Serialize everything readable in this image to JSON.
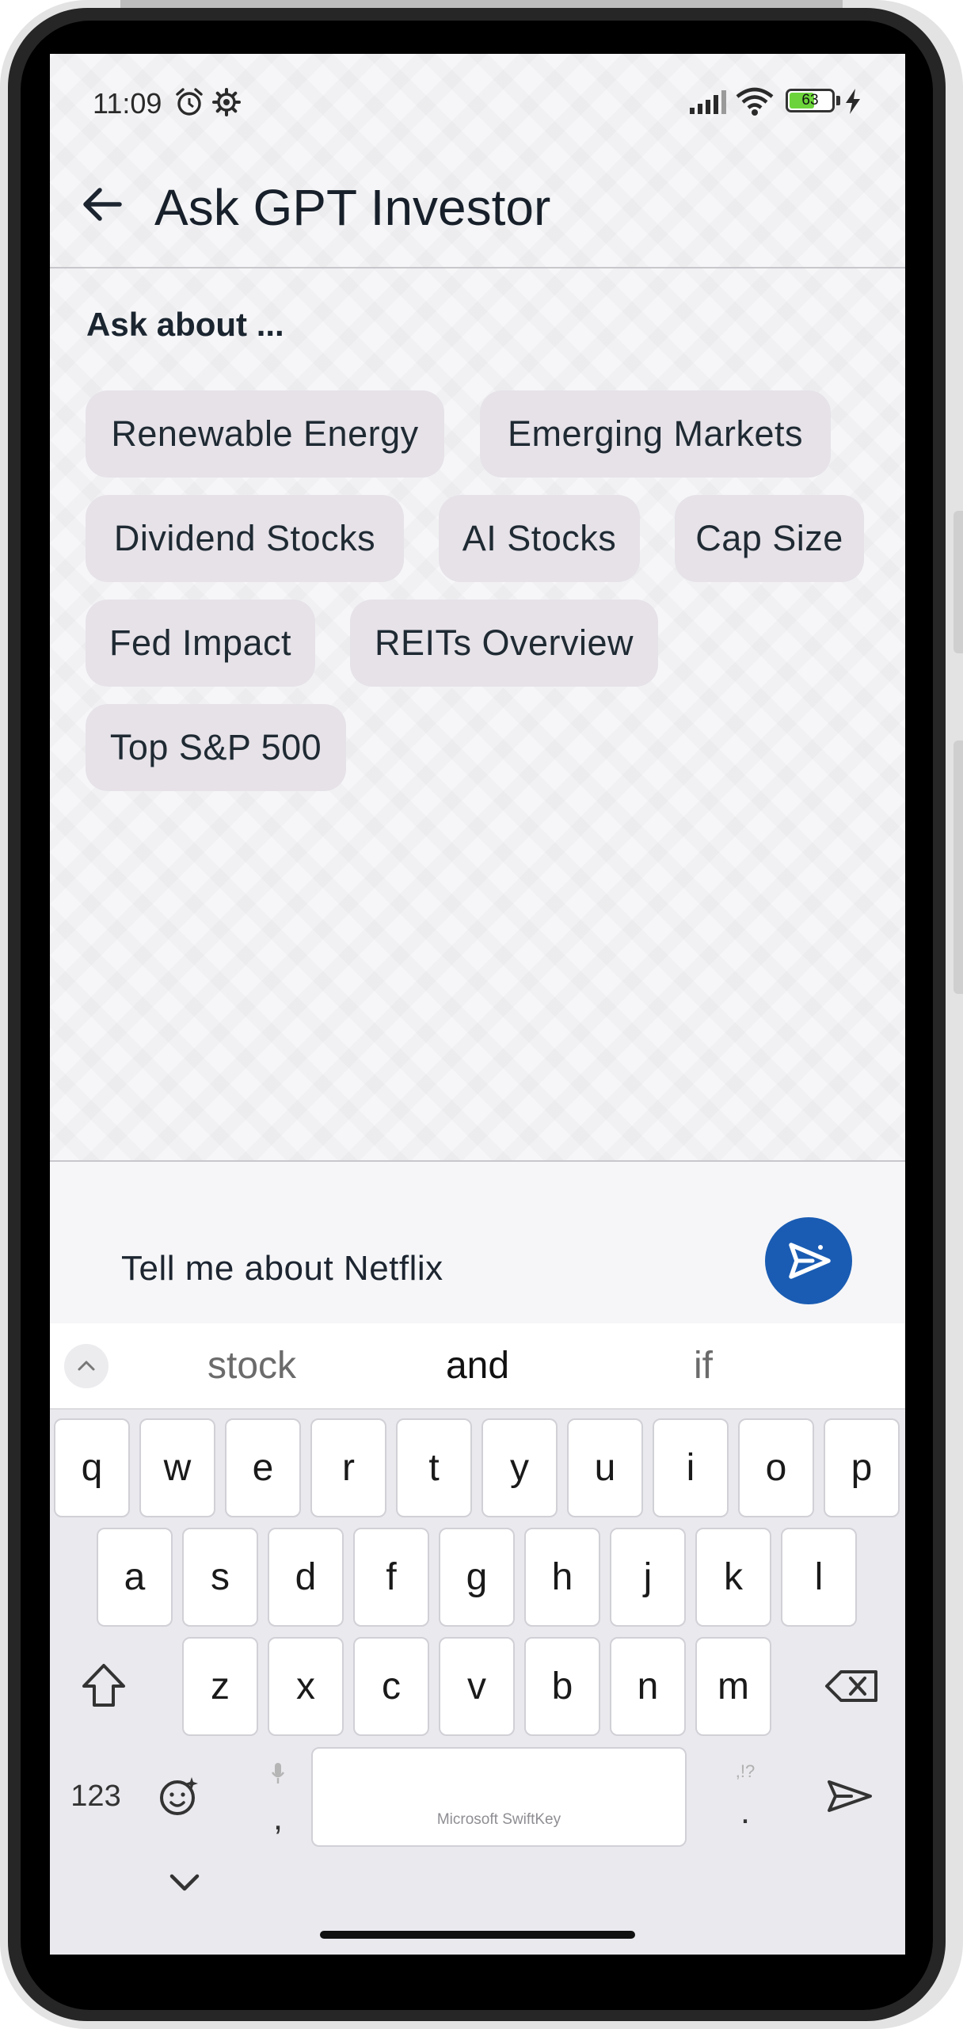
{
  "status_bar": {
    "time": "11:09",
    "battery_level": "63",
    "icons": [
      "alarm-icon",
      "settings-gear-icon",
      "signal-icon",
      "wifi-icon",
      "battery-icon",
      "charging-bolt-icon"
    ]
  },
  "app_bar": {
    "title": "Ask GPT Investor",
    "back_icon": "arrow-left-icon"
  },
  "suggestions_panel": {
    "label": "Ask about ...",
    "chips": [
      {
        "label": "Renewable Energy"
      },
      {
        "label": "Emerging Markets"
      },
      {
        "label": "Dividend Stocks"
      },
      {
        "label": "AI Stocks"
      },
      {
        "label": "Cap Size"
      },
      {
        "label": "Fed Impact"
      },
      {
        "label": "REITs Overview"
      },
      {
        "label": "Top S&P 500"
      }
    ]
  },
  "composer": {
    "value": "Tell me about Netflix",
    "send_icon": "send-icon",
    "accent_color": "#1a5cb3"
  },
  "keyboard": {
    "brand": "Microsoft SwiftKey",
    "predictions": [
      "stock",
      "and",
      "if"
    ],
    "row1": [
      "q",
      "w",
      "e",
      "r",
      "t",
      "y",
      "u",
      "i",
      "o",
      "p"
    ],
    "row2": [
      "a",
      "s",
      "d",
      "f",
      "g",
      "h",
      "j",
      "k",
      "l"
    ],
    "row3": [
      "z",
      "x",
      "c",
      "v",
      "b",
      "n",
      "m"
    ],
    "numbers_label": "123",
    "comma": ",",
    "period": ".",
    "punct_hint": ",!?"
  }
}
